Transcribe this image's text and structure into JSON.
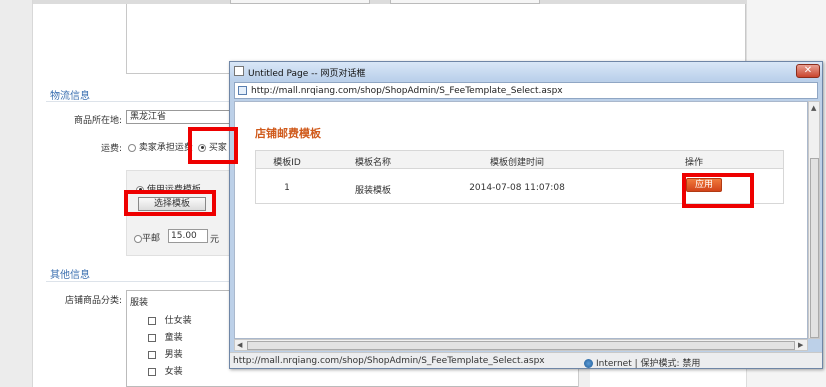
{
  "background": {
    "logistics_title": "物流信息",
    "location_label": "商品所在地:",
    "location_value": "黑龙江省",
    "shipping_label": "运费:",
    "seller_pays": "卖家承担运费",
    "buyer_pays": "买家",
    "use_template": "使用运费模板",
    "choose_template": "选择模板",
    "flat_rate": "平邮",
    "flat_rate_value": "15.00",
    "currency": "元",
    "other_title": "其他信息",
    "category_label": "店铺商品分类:",
    "category_root": "服装",
    "categories": [
      "仕女装",
      "童装",
      "男装",
      "女装"
    ]
  },
  "dialog": {
    "title": "Untitled Page -- 网页对话框",
    "close_glyph": "✕",
    "address": "http://mall.nrqiang.com/shop/ShopAdmin/S_FeeTemplate_Select.aspx",
    "heading": "店铺邮费模板",
    "table": {
      "headers": [
        "模板ID",
        "模板名称",
        "模板创建时间",
        "操作"
      ],
      "rows": [
        {
          "id": "1",
          "name": "服装模板",
          "created": "2014-07-08 11:07:08",
          "action": "应用"
        }
      ]
    },
    "status_url": "http://mall.nrqiang.com/shop/ShopAdmin/S_FeeTemplate_Select.aspx",
    "status_zone": "Internet | 保护模式: 禁用"
  },
  "colors": {
    "highlight": "#ee0000",
    "heading": "#d05a1b",
    "apply_button": "#e0561f",
    "section_title": "#3a6fb0"
  }
}
